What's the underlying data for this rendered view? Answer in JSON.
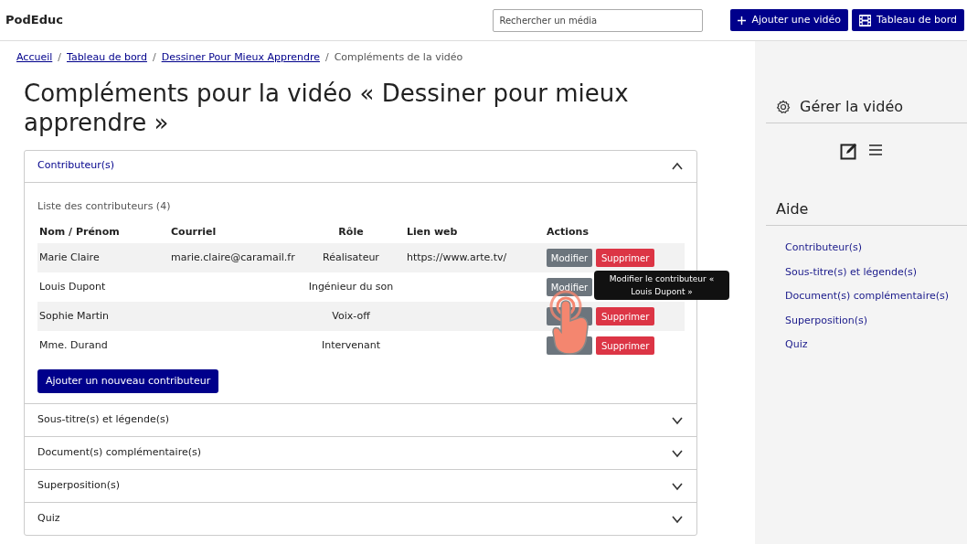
{
  "header": {
    "brand": "PodEduc",
    "search": {
      "placeholder": "Rechercher un média"
    },
    "buttons": [
      {
        "kind": "add",
        "label": "Ajouter une vidéo"
      },
      {
        "kind": "dashboard",
        "label": "Tableau de bord"
      }
    ]
  },
  "breadcrumb_separators": [
    "/",
    "/",
    "/"
  ],
  "breadcrumb": [
    {
      "label": "Accueil",
      "link": true
    },
    {
      "label": "Tableau de bord",
      "link": true
    },
    {
      "label": "Dessiner Pour Mieux Apprendre",
      "link": true
    },
    {
      "label": "Compléments de la vidéo",
      "link": false
    }
  ],
  "title": "Compléments pour la vidéo « Dessiner pour mieux apprendre »",
  "sections": [
    {
      "title": "Contributeur(s)",
      "expanded": true
    },
    {
      "title": "Sous-titre(s) et légende(s)",
      "expanded": false
    },
    {
      "title": "Document(s) complémentaire(s)",
      "expanded": false
    },
    {
      "title": "Superposition(s)",
      "expanded": false
    },
    {
      "title": "Quiz",
      "expanded": false
    }
  ],
  "contributors": {
    "caption": "Liste des contributeurs (4)",
    "columns": [
      "Nom / Prénom",
      "Courriel",
      "Rôle",
      "Lien web",
      "Actions"
    ],
    "rows": [
      {
        "name": "Marie Claire",
        "email": "marie.claire@caramail.fr",
        "role": "Réalisateur",
        "link": "https://www.arte.tv/",
        "actions": [
          {
            "kind": "modify",
            "label": "Modifier"
          },
          {
            "kind": "delete",
            "label": "Supprimer"
          }
        ]
      },
      {
        "name": "Louis Dupont",
        "role": "Ingénieur du son",
        "actions": [
          {
            "kind": "modify",
            "label": "Modifier"
          }
        ]
      },
      {
        "name": "Sophie Martin",
        "role": "Voix-off",
        "actions": [
          {
            "kind": "modify"
          },
          {
            "kind": "delete",
            "label": "Supprimer"
          }
        ]
      },
      {
        "name": "Mme. Durand",
        "role": "Intervenant",
        "actions": [
          {
            "kind": "modify"
          },
          {
            "kind": "delete",
            "label": "Supprimer"
          }
        ]
      }
    ],
    "add_button": "Ajouter un nouveau contributeur",
    "tooltip": "Modifier le contributeur « Louis Dupont »"
  },
  "sidebar": {
    "manage_title": "Gérer la vidéo",
    "help_title": "Aide",
    "help_links": [
      "Contributeur(s)",
      "Sous-titre(s) et légende(s)",
      "Document(s) complémentaire(s)",
      "Superposition(s)",
      "Quiz"
    ]
  }
}
